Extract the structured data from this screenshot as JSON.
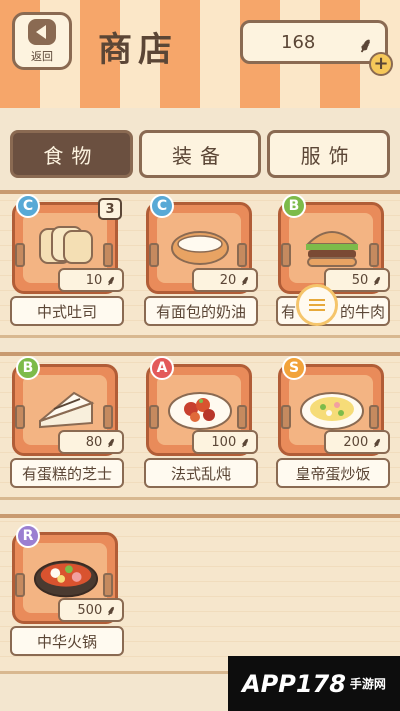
{
  "header": {
    "back_label": "返回",
    "title": "商店",
    "coins": "168",
    "plus": "+"
  },
  "tabs": [
    {
      "label": "食物",
      "active": true
    },
    {
      "label": "装备",
      "active": false
    },
    {
      "label": "服饰",
      "active": false
    }
  ],
  "items": [
    {
      "name": "中式吐司",
      "grade": "C",
      "price": "10",
      "count": "3"
    },
    {
      "name": "有面包的奶油",
      "grade": "C",
      "price": "20"
    },
    {
      "name": "有",
      "name2": "的牛肉",
      "grade": "B",
      "price": "50"
    },
    {
      "name": "有蛋糕的芝士",
      "grade": "B",
      "price": "80"
    },
    {
      "name": "法式乱炖",
      "grade": "A",
      "price": "100"
    },
    {
      "name": "皇帝蛋炒饭",
      "grade": "S",
      "price": "200"
    },
    {
      "name": "中华火锅",
      "grade": "R",
      "price": "500"
    }
  ],
  "grade_colors": {
    "C": "#58a9d6",
    "B": "#7dbb4a",
    "A": "#e35a5a",
    "S": "#f2a33a",
    "R": "#9b7fd1"
  },
  "watermark": {
    "brand": "APP178",
    "suffix": "手游网"
  }
}
